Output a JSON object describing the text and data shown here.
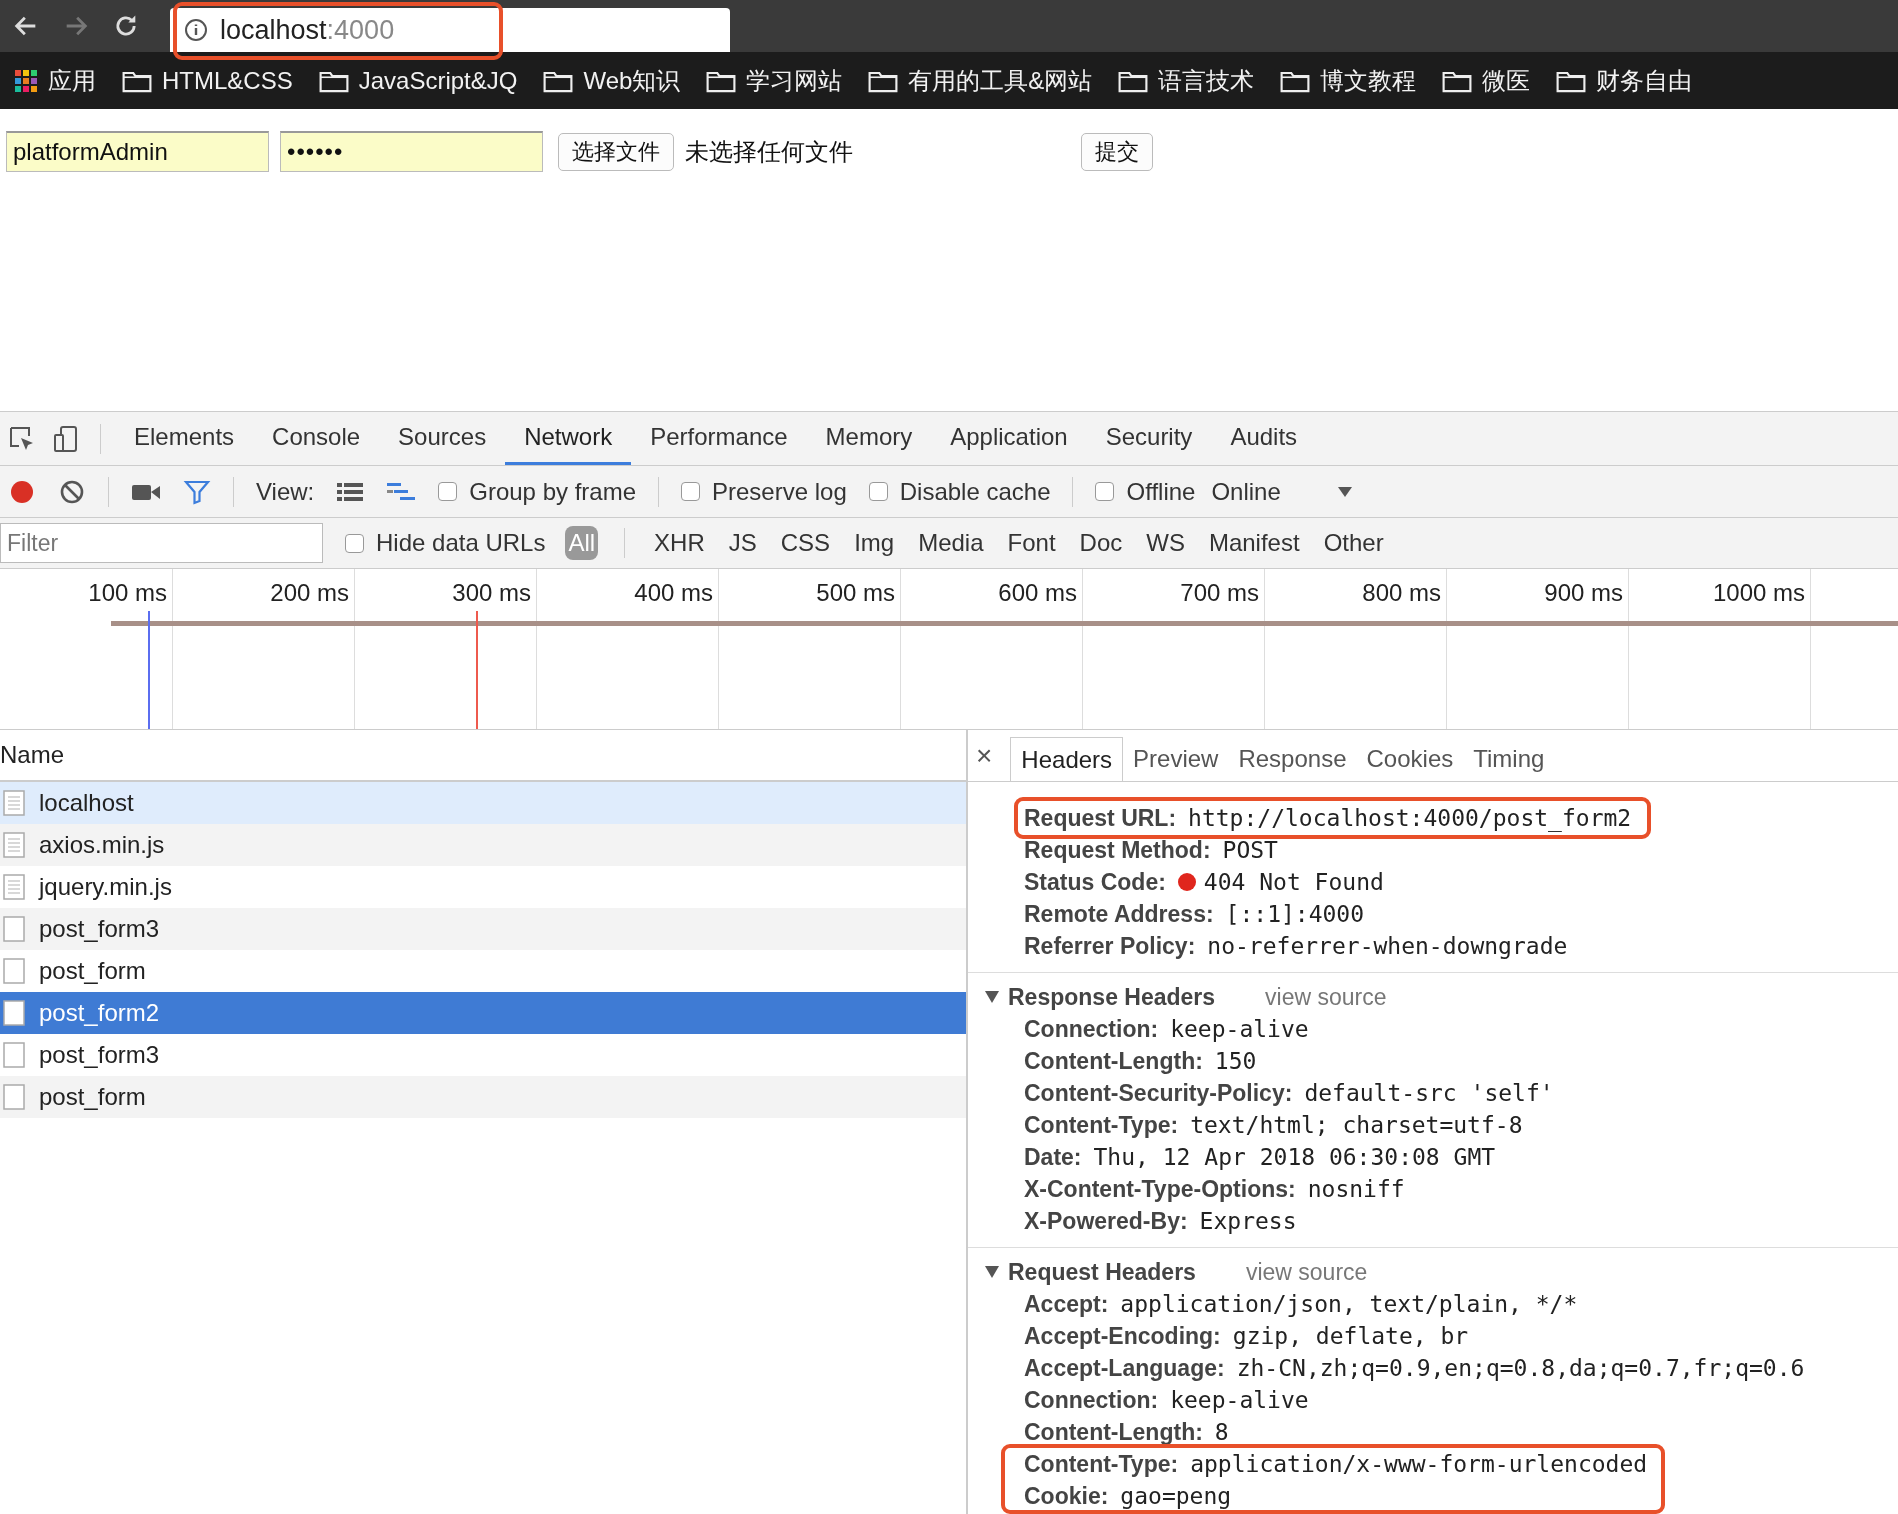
{
  "browser": {
    "url_host": "localhost",
    "url_port": ":4000"
  },
  "bookmarks": [
    {
      "label": "应用",
      "kind": "apps"
    },
    {
      "label": "HTML&CSS",
      "kind": "folder"
    },
    {
      "label": "JavaScript&JQ",
      "kind": "folder"
    },
    {
      "label": "Web知识",
      "kind": "folder"
    },
    {
      "label": "学习网站",
      "kind": "folder"
    },
    {
      "label": "有用的工具&网站",
      "kind": "folder"
    },
    {
      "label": "语言技术",
      "kind": "folder"
    },
    {
      "label": "博文教程",
      "kind": "folder"
    },
    {
      "label": "微医",
      "kind": "folder"
    },
    {
      "label": "财务自由",
      "kind": "folder"
    }
  ],
  "form": {
    "username": "platformAdmin",
    "password": "••••••",
    "file_button": "选择文件",
    "file_status": "未选择任何文件",
    "submit": "提交"
  },
  "devtools": {
    "tabs": [
      {
        "label": "Elements",
        "selected": false
      },
      {
        "label": "Console",
        "selected": false
      },
      {
        "label": "Sources",
        "selected": false
      },
      {
        "label": "Network",
        "selected": true
      },
      {
        "label": "Performance",
        "selected": false
      },
      {
        "label": "Memory",
        "selected": false
      },
      {
        "label": "Application",
        "selected": false
      },
      {
        "label": "Security",
        "selected": false
      },
      {
        "label": "Audits",
        "selected": false
      }
    ],
    "toolbar": {
      "recording": true,
      "view_label": "View:",
      "checkboxes": [
        {
          "label": "Group by frame",
          "checked": false
        },
        {
          "label": "Preserve log",
          "checked": false
        },
        {
          "label": "Disable cache",
          "checked": false
        },
        {
          "label": "Offline",
          "checked": false
        }
      ],
      "throttling": "Online"
    },
    "filter": {
      "placeholder": "Filter",
      "hide_data_urls": {
        "label": "Hide data URLs",
        "checked": false
      },
      "types": [
        {
          "label": "All",
          "selected": true
        },
        {
          "label": "XHR",
          "selected": false
        },
        {
          "label": "JS",
          "selected": false
        },
        {
          "label": "CSS",
          "selected": false
        },
        {
          "label": "Img",
          "selected": false
        },
        {
          "label": "Media",
          "selected": false
        },
        {
          "label": "Font",
          "selected": false
        },
        {
          "label": "Doc",
          "selected": false
        },
        {
          "label": "WS",
          "selected": false
        },
        {
          "label": "Manifest",
          "selected": false
        },
        {
          "label": "Other",
          "selected": false
        }
      ]
    },
    "timeline": {
      "ticks": [
        "100 ms",
        "200 ms",
        "300 ms",
        "400 ms",
        "500 ms",
        "600 ms",
        "700 ms",
        "800 ms",
        "900 ms",
        "1000 ms"
      ]
    },
    "requests": {
      "column": "Name",
      "rows": [
        {
          "name": "localhost",
          "kind": "document",
          "selected": false,
          "hovered": true
        },
        {
          "name": "axios.min.js",
          "kind": "document",
          "selected": false,
          "hovered": false
        },
        {
          "name": "jquery.min.js",
          "kind": "document",
          "selected": false,
          "hovered": false
        },
        {
          "name": "post_form3",
          "kind": "blank",
          "selected": false,
          "hovered": false
        },
        {
          "name": "post_form",
          "kind": "blank",
          "selected": false,
          "hovered": false
        },
        {
          "name": "post_form2",
          "kind": "blank",
          "selected": true,
          "hovered": false
        },
        {
          "name": "post_form3",
          "kind": "blank",
          "selected": false,
          "hovered": false
        },
        {
          "name": "post_form",
          "kind": "blank",
          "selected": false,
          "hovered": false
        }
      ]
    },
    "detail": {
      "close": "×",
      "tabs": [
        {
          "label": "Headers",
          "selected": true
        },
        {
          "label": "Preview",
          "selected": false
        },
        {
          "label": "Response",
          "selected": false
        },
        {
          "label": "Cookies",
          "selected": false
        },
        {
          "label": "Timing",
          "selected": false
        }
      ],
      "general": [
        {
          "label": "Request URL:",
          "value": "http://localhost:4000/post_form2",
          "highlighted": true
        },
        {
          "label": "Request Method:",
          "value": "POST",
          "highlighted": false
        },
        {
          "label": "Status Code:",
          "value": "404 Not Found",
          "color": "#e0261d",
          "highlighted": false
        },
        {
          "label": "Remote Address:",
          "value": "[::1]:4000",
          "highlighted": false
        },
        {
          "label": "Referrer Policy:",
          "value": "no-referrer-when-downgrade",
          "highlighted": false
        }
      ],
      "sections": [
        {
          "title": "Response Headers",
          "link": "view source",
          "expanded": true,
          "rows": [
            {
              "label": "Connection:",
              "value": "keep-alive"
            },
            {
              "label": "Content-Length:",
              "value": "150"
            },
            {
              "label": "Content-Security-Policy:",
              "value": "default-src 'self'"
            },
            {
              "label": "Content-Type:",
              "value": "text/html; charset=utf-8"
            },
            {
              "label": "Date:",
              "value": "Thu, 12 Apr 2018 06:30:08 GMT"
            },
            {
              "label": "X-Content-Type-Options:",
              "value": "nosniff"
            },
            {
              "label": "X-Powered-By:",
              "value": "Express"
            }
          ]
        },
        {
          "title": "Request Headers",
          "link": "view source",
          "expanded": true,
          "rows": [
            {
              "label": "Accept:",
              "value": "application/json, text/plain, */*"
            },
            {
              "label": "Accept-Encoding:",
              "value": "gzip, deflate, br"
            },
            {
              "label": "Accept-Language:",
              "value": "zh-CN,zh;q=0.9,en;q=0.8,da;q=0.7,fr;q=0.6"
            },
            {
              "label": "Connection:",
              "value": "keep-alive"
            },
            {
              "label": "Content-Length:",
              "value": "8"
            },
            {
              "label": "Content-Type:",
              "value": "application/x-www-form-urlencoded"
            },
            {
              "label": "Cookie:",
              "value": "gao=peng"
            }
          ]
        }
      ]
    }
  }
}
